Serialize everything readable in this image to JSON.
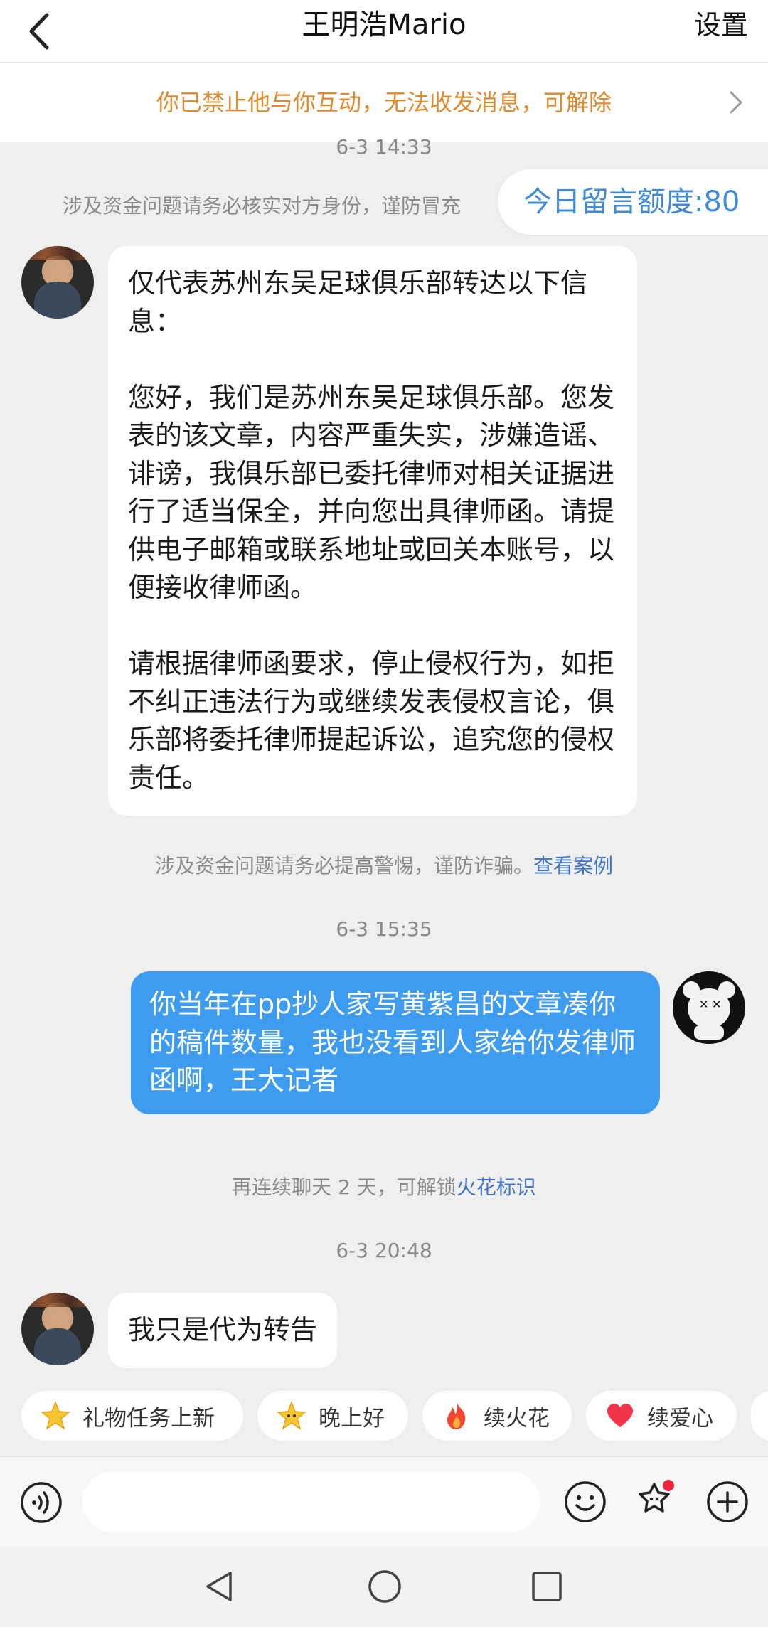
{
  "header": {
    "title": "王明浩Mario",
    "settings_label": "设置"
  },
  "notice": {
    "text": "你已禁止他与你互动，无法收发消息，可解除"
  },
  "chat": {
    "time_1": "6-3 14:33",
    "warning_1": "涉及资金问题请务必核实对方身份，谨防冒充",
    "quota_label": "今日留言额度:80",
    "msg_1": "仅代表苏州东吴足球俱乐部转达以下信息：\n\n您好，我们是苏州东吴足球俱乐部。您发表的该文章，内容严重失实，涉嫌造谣、诽谤，我俱乐部已委托律师对相关证据进行了适当保全，并向您出具律师函。请提供电子邮箱或联系地址或回关本账号，以便接收律师函。\n\n请根据律师函要求，停止侵权行为，如拒不纠正违法行为或继续发表侵权言论，俱乐部将委托律师提起诉讼，追究您的侵权责任。",
    "warning_2": "涉及资金问题请务必提高警惕，谨防诈骗。",
    "warning_2_link": "查看案例",
    "time_2": "6-3 15:35",
    "msg_2": "你当年在pp抄人家写黄紫昌的文章凑你的稿件数量，我也没看到人家给你发律师函啊，王大记者",
    "spark_text": "再连续聊天 2 天，可解锁",
    "spark_link": "火花标识",
    "time_3": "6-3 20:48",
    "msg_3": "我只是代为转告"
  },
  "quick_replies": [
    {
      "icon": "star-icon",
      "label": "礼物任务上新"
    },
    {
      "icon": "star-face-icon",
      "label": "晚上好"
    },
    {
      "icon": "fire-icon",
      "label": "续火花"
    },
    {
      "icon": "heart-icon",
      "label": "续爱心"
    }
  ],
  "input": {
    "placeholder": "",
    "value": ""
  },
  "colors": {
    "accent_blue": "#3d9bf0",
    "notice_orange": "#e08a2e",
    "link_blue": "#3f74c7"
  }
}
